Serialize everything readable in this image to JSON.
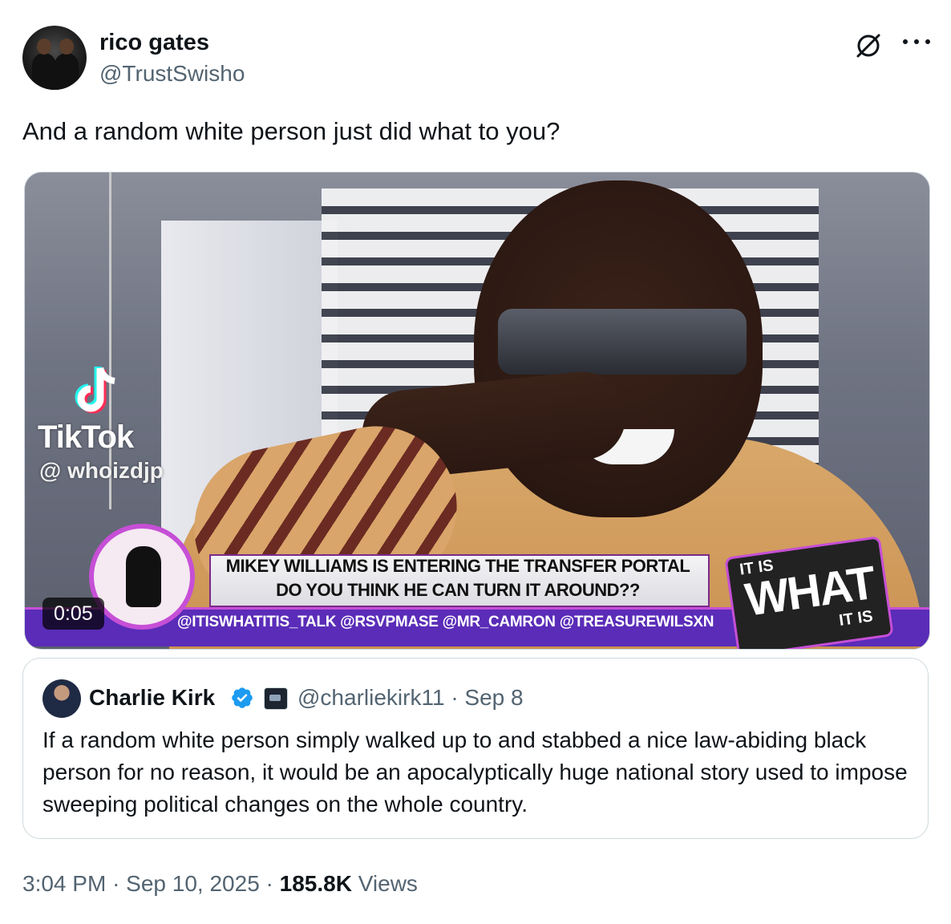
{
  "author": {
    "name": "rico gates",
    "handle": "@TrustSwisho"
  },
  "tweet": {
    "text": "And a random white person just did what to you?"
  },
  "media": {
    "type": "video",
    "duration": "0:05",
    "overlay": {
      "tiktok_brand": "TikTok",
      "tiktok_handle": "@ whoizdjp",
      "headline_line1": "MIKEY WILLIAMS IS ENTERING THE TRANSFER PORTAL",
      "headline_line2": "DO YOU THINK HE CAN TURN IT AROUND??",
      "social_line": "@ITISWHATITIS_TALK @RSVPMASE @MR_CAMRON @TREASUREWILSXN",
      "badge_top": "IT IS",
      "badge_main": "WHAT",
      "badge_bottom": "IT IS"
    }
  },
  "quoted_tweet": {
    "name": "Charlie Kirk",
    "handle": "@charliekirk11",
    "date": "· Sep 8",
    "verified": true,
    "text": "If a random white person simply walked up to and stabbed a nice law-abiding black person for no reason, it would be an apocalyptically huge national story used to impose sweeping political changes on the whole country."
  },
  "meta": {
    "time": "3:04 PM",
    "sep1": "·",
    "date": "Sep 10, 2025",
    "sep2": "·",
    "views_count": "185.8K",
    "views_label": "Views"
  },
  "icons": {
    "grok": "grok-icon",
    "more": "more-icon",
    "verified": "verified-badge-icon",
    "verified_color": "#1d9bf0"
  },
  "colors": {
    "text_primary": "#0f1419",
    "text_secondary": "#536471",
    "border": "#cfd9de"
  }
}
